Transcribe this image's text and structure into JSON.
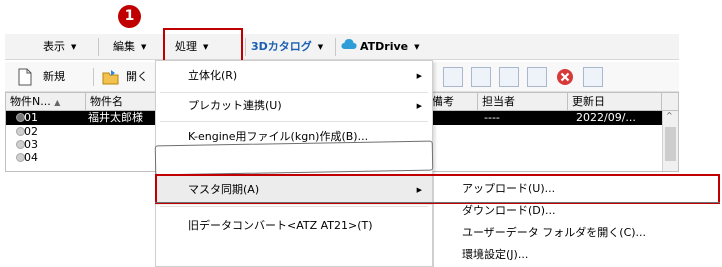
{
  "menubar": {
    "view_label": "表示",
    "edit_label": "編集",
    "process_label": "処理",
    "catalog_label": "3Dカタログ",
    "atdrive_label": "ATDrive"
  },
  "callout": {
    "number": "1"
  },
  "toolbar": {
    "new_label": "新規",
    "open_label": "開く"
  },
  "table": {
    "headers": [
      "物件N...",
      "物件名",
      "備考",
      "担当者",
      "更新日"
    ],
    "selected_row": {
      "id": "01",
      "name": "福井太郎様",
      "person": "----",
      "date": "2022/09/..."
    },
    "rows": [
      "02",
      "03",
      "04"
    ]
  },
  "dropdown": {
    "items": [
      {
        "label": "立体化(R)",
        "has_submenu": true
      },
      {
        "label": "プレカット連携(U)",
        "has_submenu": true
      },
      {
        "label": "K-engine用ファイル(kgn)作成(B)...",
        "has_submenu": false
      },
      {
        "label": "マスタ同期(A)",
        "has_submenu": true
      },
      {
        "label": "旧データコンバート<ATZ AT21>(T)",
        "has_submenu": false
      }
    ]
  },
  "submenu": {
    "items": [
      "アップロード(U)...",
      "ダウンロード(D)...",
      "ユーザーデータ フォルダを開く(C)...",
      "環境設定(J)..."
    ]
  },
  "colors": {
    "accent_red": "#c00000",
    "selection": "#000000"
  }
}
